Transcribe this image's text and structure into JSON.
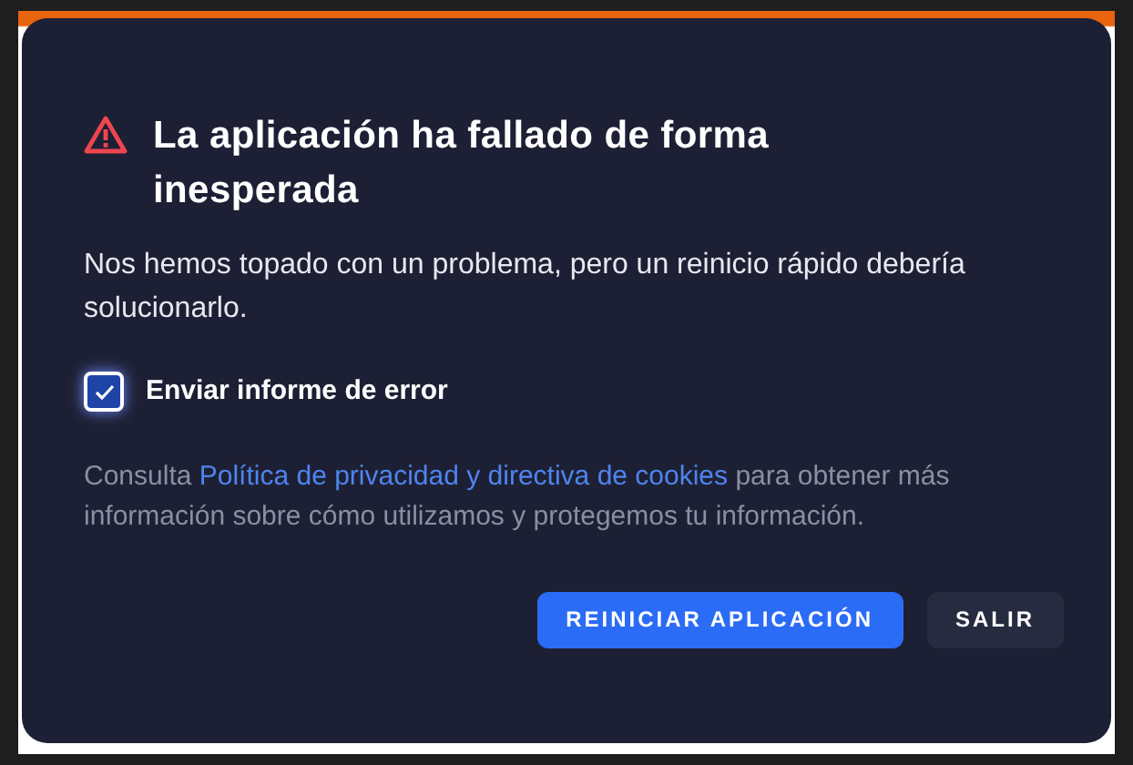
{
  "dialog": {
    "title": "La aplicación ha fallado de forma inesperada",
    "message": "Nos hemos topado con un problema, pero un reinicio rápido debería solucionarlo.",
    "checkbox": {
      "label": "Enviar informe de error",
      "checked": true
    },
    "privacy": {
      "before": "Consulta",
      "link": "Política de privacidad y directiva de cookies",
      "after": "para obtener más información sobre cómo utilizamos y protegemos tu información."
    },
    "buttons": [
      {
        "label": "REINICIAR APLICACIÓN",
        "kind": "primary"
      },
      {
        "label": "SALIR",
        "kind": "secondary"
      }
    ]
  }
}
